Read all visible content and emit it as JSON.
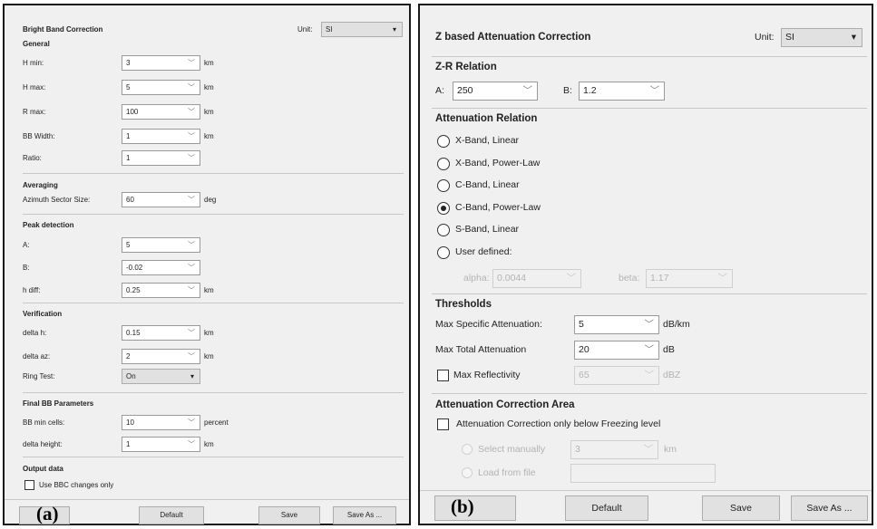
{
  "panel_a": {
    "title": "Bright Band Correction",
    "unit_label": "Unit:",
    "unit_value": "SI",
    "general": {
      "heading": "General",
      "rows": [
        {
          "label": "H min:",
          "value": "3",
          "unit": "km"
        },
        {
          "label": "H max:",
          "value": "5",
          "unit": "km"
        },
        {
          "label": "R max:",
          "value": "100",
          "unit": "km"
        },
        {
          "label": "BB Width:",
          "value": "1",
          "unit": "km"
        },
        {
          "label": "Ratio:",
          "value": "1",
          "unit": ""
        }
      ]
    },
    "averaging": {
      "heading": "Averaging",
      "label": "Azimuth Sector Size:",
      "value": "60",
      "unit": "deg"
    },
    "peak": {
      "heading": "Peak detection",
      "rows": [
        {
          "label": "A:",
          "value": "5",
          "unit": ""
        },
        {
          "label": "B:",
          "value": "-0.02",
          "unit": ""
        },
        {
          "label": "h diff:",
          "value": "0.25",
          "unit": "km"
        }
      ]
    },
    "verification": {
      "heading": "Verification",
      "rows": [
        {
          "label": "delta h:",
          "value": "0.15",
          "unit": "km"
        },
        {
          "label": "delta az:",
          "value": "2",
          "unit": "km"
        }
      ],
      "ring_label": "Ring Test:",
      "ring_value": "On"
    },
    "final": {
      "heading": "Final BB Parameters",
      "rows": [
        {
          "label": "BB min cells:",
          "value": "10",
          "unit": "percent"
        },
        {
          "label": "delta height:",
          "value": "1",
          "unit": "km"
        }
      ]
    },
    "output": {
      "heading": "Output data",
      "checkbox_label": "Use BBC changes only",
      "checked": false
    },
    "buttons": {
      "default": "Default",
      "save": "Save",
      "save_as": "Save As ..."
    },
    "figure_tag": "(a)"
  },
  "panel_b": {
    "title": "Z based Attenuation Correction",
    "unit_label": "Unit:",
    "unit_value": "SI",
    "zr": {
      "heading": "Z-R Relation",
      "a_label": "A:",
      "a_value": "250",
      "b_label": "B:",
      "b_value": "1.2"
    },
    "atten_relation": {
      "heading": "Attenuation Relation",
      "options": [
        {
          "label": "X-Band, Linear",
          "selected": false
        },
        {
          "label": "X-Band, Power-Law",
          "selected": false
        },
        {
          "label": "C-Band, Linear",
          "selected": false
        },
        {
          "label": "C-Band, Power-Law",
          "selected": true
        },
        {
          "label": "S-Band, Linear",
          "selected": false
        },
        {
          "label": "User defined:",
          "selected": false
        }
      ],
      "alpha_label": "alpha:",
      "alpha_value": "0.0044",
      "beta_label": "beta:",
      "beta_value": "1.17"
    },
    "thresholds": {
      "heading": "Thresholds",
      "rows": [
        {
          "label": "Max Specific Attenuation:",
          "value": "5",
          "unit": "dB/km"
        },
        {
          "label": "Max Total Attenuation",
          "value": "20",
          "unit": "dB"
        }
      ],
      "reflectivity_label": "Max Reflectivity",
      "reflectivity_value": "65",
      "reflectivity_unit": "dBZ",
      "reflectivity_checked": false
    },
    "area": {
      "heading": "Attenuation Correction Area",
      "checkbox_label": "Attenuation Correction only below Freezing level",
      "checked": false,
      "manual_label": "Select manually",
      "manual_value": "3",
      "manual_unit": "km",
      "file_label": "Load from file"
    },
    "buttons": {
      "default": "Default",
      "save": "Save",
      "save_as": "Save As ..."
    },
    "figure_tag": "(b)"
  }
}
